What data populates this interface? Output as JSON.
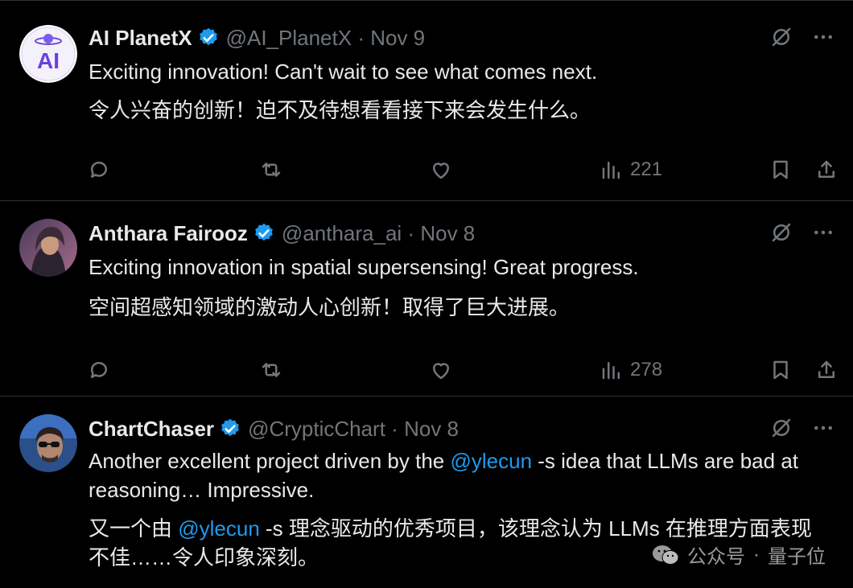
{
  "tweets": [
    {
      "name": "AI PlanetX",
      "handle": "@AI_PlanetX",
      "date": "Nov 9",
      "line1": "Exciting innovation! Can't wait to see what comes next.",
      "line2": "令人兴奋的创新！迫不及待想看看接下来会发生什么。",
      "views": "221",
      "avatar_text": "AI"
    },
    {
      "name": "Anthara Fairooz",
      "handle": "@anthara_ai",
      "date": "Nov 8",
      "line1": "Exciting innovation in spatial supersensing! Great progress.",
      "line2": "空间超感知领域的激动人心创新！取得了巨大进展。",
      "views": "278"
    },
    {
      "name": "ChartChaser",
      "handle": "@CrypticChart",
      "date": "Nov 8",
      "line1_a": "Another excellent project driven by the ",
      "line1_mention": "@ylecun",
      "line1_b": " -s idea that LLMs are bad at reasoning… Impressive.",
      "line2_a": "又一个由 ",
      "line2_mention": "@ylecun",
      "line2_b": " -s 理念驱动的优秀项目，该理念认为 LLMs 在推理方面表现不佳……令人印象深刻。"
    }
  ],
  "separator": "·",
  "watermark": {
    "source": "公众号",
    "dot": "·",
    "brand": "量子位"
  },
  "colors": {
    "background": "#000000",
    "text": "#e7e9ea",
    "muted": "#71767b",
    "accent": "#1d9bf0",
    "border": "#2f3336"
  },
  "icons": [
    "verified-badge-icon",
    "grok-icon",
    "more-icon",
    "reply-icon",
    "retweet-icon",
    "like-icon",
    "views-icon",
    "bookmark-icon",
    "share-icon",
    "wechat-icon"
  ]
}
